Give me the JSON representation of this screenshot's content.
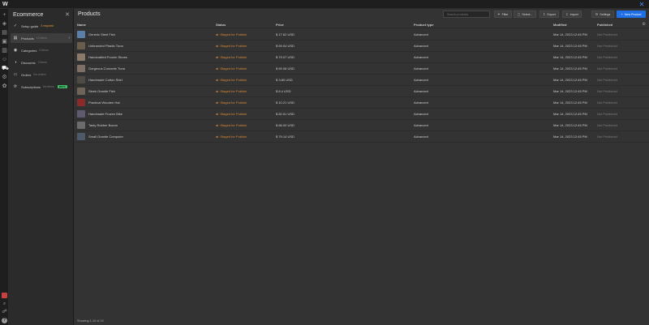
{
  "app": {
    "logo": "W",
    "close_glyph": "✕"
  },
  "rail": {
    "icons": [
      "add-icon",
      "navigator-icon",
      "pages-icon",
      "cms-icon",
      "assets-icon",
      "users-icon",
      "ecommerce-icon",
      "logic-icon",
      "settings-icon"
    ],
    "bottom": [
      "audit-icon",
      "search-icon",
      "users-cursor-icon",
      "help-icon"
    ]
  },
  "panel": {
    "title": "Ecommerce",
    "close_glyph": "✕",
    "items": [
      {
        "label": "Setup guide",
        "badge": "3 required",
        "badge_color": "#e59a3a",
        "icon": "check-circle-icon",
        "icon_glyph": "✓"
      },
      {
        "label": "Products",
        "badge": "10 items",
        "icon": "product-icon",
        "icon_glyph": "▤",
        "active": true,
        "chevron": "›"
      },
      {
        "label": "Categories",
        "badge": "0 items",
        "icon": "category-icon",
        "icon_glyph": "◉"
      },
      {
        "label": "Discounts",
        "badge": "0 items",
        "icon": "discount-icon",
        "icon_glyph": "◑"
      },
      {
        "label": "Orders",
        "badge": "No orders",
        "icon": "orders-icon",
        "icon_glyph": "▭"
      },
      {
        "label": "Subscriptions",
        "badge": "No items",
        "icon": "subscriptions-icon",
        "icon_glyph": "⟳",
        "beta": "BETA"
      }
    ]
  },
  "main": {
    "title": "Products",
    "search_placeholder": "Search products",
    "buttons": {
      "filter": "Filter",
      "select": "Select...",
      "export": "Export",
      "import": "Import",
      "settings": "Settings",
      "new_product": "New Product"
    },
    "columns": [
      "Name",
      "Status",
      "Price",
      "Product type",
      "Modified",
      "Published"
    ],
    "rows": [
      {
        "name": "Generic Steel Fish",
        "status": "Staged for Publish",
        "price": "$ 17.62 USD",
        "type": "Advanced",
        "modified": "Mar 14, 2023 12:45 PM",
        "published": "Not Published",
        "thumb": "#5a7fa8"
      },
      {
        "name": "Unbranded Plastic Tuna",
        "status": "Staged for Publish",
        "price": "$ 69.04 USD",
        "type": "Advanced",
        "modified": "Mar 14, 2023 12:45 PM",
        "published": "Not Published",
        "thumb": "#6a5d4c"
      },
      {
        "name": "Handcrafted Frozen Shoes",
        "status": "Staged for Publish",
        "price": "$ 79.07 USD",
        "type": "Advanced",
        "modified": "Mar 14, 2023 12:45 PM",
        "published": "Not Published",
        "thumb": "#8b7a6a"
      },
      {
        "name": "Gorgeous Concrete Tuna",
        "status": "Staged for Publish",
        "price": "$ 69.08 USD",
        "type": "Advanced",
        "modified": "Mar 14, 2023 12:45 PM",
        "published": "Not Published",
        "thumb": "#7e7066"
      },
      {
        "name": "Handmade Cotton Shirt",
        "status": "Staged for Publish",
        "price": "$ 3.80 USD",
        "type": "Advanced",
        "modified": "Mar 14, 2023 12:45 PM",
        "published": "Not Published",
        "thumb": "#4e4a44"
      },
      {
        "name": "Sleek Granite Fish",
        "status": "Staged for Publish",
        "price": "$ 8.4 USD",
        "type": "Advanced",
        "modified": "Mar 14, 2023 12:45 PM",
        "published": "Not Published",
        "thumb": "#6e6458"
      },
      {
        "name": "Practical Wooden Hat",
        "status": "Staged for Publish",
        "price": "$ 10.21 USD",
        "type": "Advanced",
        "modified": "Mar 14, 2023 12:45 PM",
        "published": "Not Published",
        "thumb": "#8a2a2a"
      },
      {
        "name": "Handmade Frozen Bike",
        "status": "Staged for Publish",
        "price": "$ 82.51 USD",
        "type": "Advanced",
        "modified": "Mar 14, 2023 12:45 PM",
        "published": "Not Published",
        "thumb": "#5f5a70"
      },
      {
        "name": "Tasty Rubber Bacon",
        "status": "Staged for Publish",
        "price": "$ 66.00 USD",
        "type": "Advanced",
        "modified": "Mar 14, 2023 12:45 PM",
        "published": "Not Published",
        "thumb": "#6c6c6c"
      },
      {
        "name": "Small Granite Computer",
        "status": "Staged for Publish",
        "price": "$ 79.14 USD",
        "type": "Advanced",
        "modified": "Mar 14, 2023 12:45 PM",
        "published": "Not Published",
        "thumb": "#4d5a6a"
      }
    ],
    "footer": "Showing 1-10 of 10"
  }
}
